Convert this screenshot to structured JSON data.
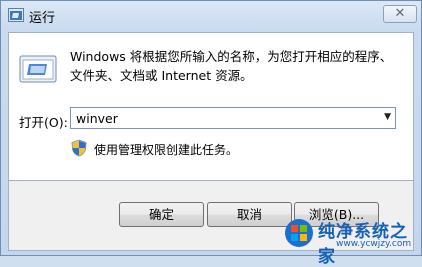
{
  "window": {
    "title": "运行",
    "title_icon": "run-icon",
    "close_glyph": "✕"
  },
  "dialog": {
    "description": "Windows 将根据您所输入的名称，为您打开相应的程序、文件夹、文档或 Internet 资源。",
    "open_label": "打开(O):",
    "open_value": "winver",
    "admin_note": "使用管理权限创建此任务。",
    "shield_icon": "uac-shield-icon"
  },
  "buttons": {
    "ok": "确定",
    "cancel": "取消",
    "browse": "浏览(B)..."
  },
  "watermark": {
    "text": "纯净系统之家",
    "url": "www.ycwjzy.com"
  },
  "colors": {
    "accent": "#1660b8",
    "frame": "#c3d6ec"
  }
}
